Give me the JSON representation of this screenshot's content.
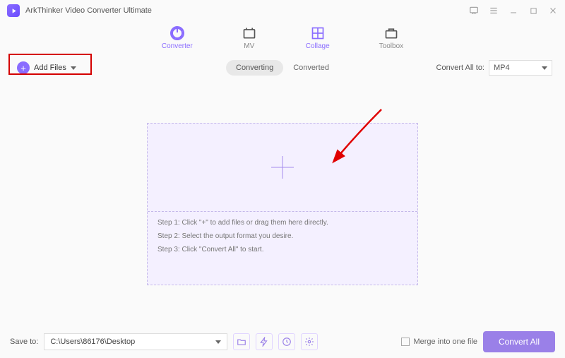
{
  "app": {
    "title": "ArkThinker Video Converter Ultimate"
  },
  "tabs": {
    "converter": "Converter",
    "mv": "MV",
    "collage": "Collage",
    "toolbox": "Toolbox"
  },
  "addfiles": {
    "label": "Add Files"
  },
  "toggle": {
    "converting": "Converting",
    "converted": "Converted"
  },
  "convertto": {
    "label": "Convert All to:",
    "value": "MP4"
  },
  "steps": {
    "s1": "Step 1: Click \"+\" to add files or drag them here directly.",
    "s2": "Step 2: Select the output format you desire.",
    "s3": "Step 3: Click \"Convert All\" to start."
  },
  "bottom": {
    "saveto": "Save to:",
    "path": "C:\\Users\\86176\\Desktop",
    "merge": "Merge into one file",
    "convert": "Convert All"
  }
}
